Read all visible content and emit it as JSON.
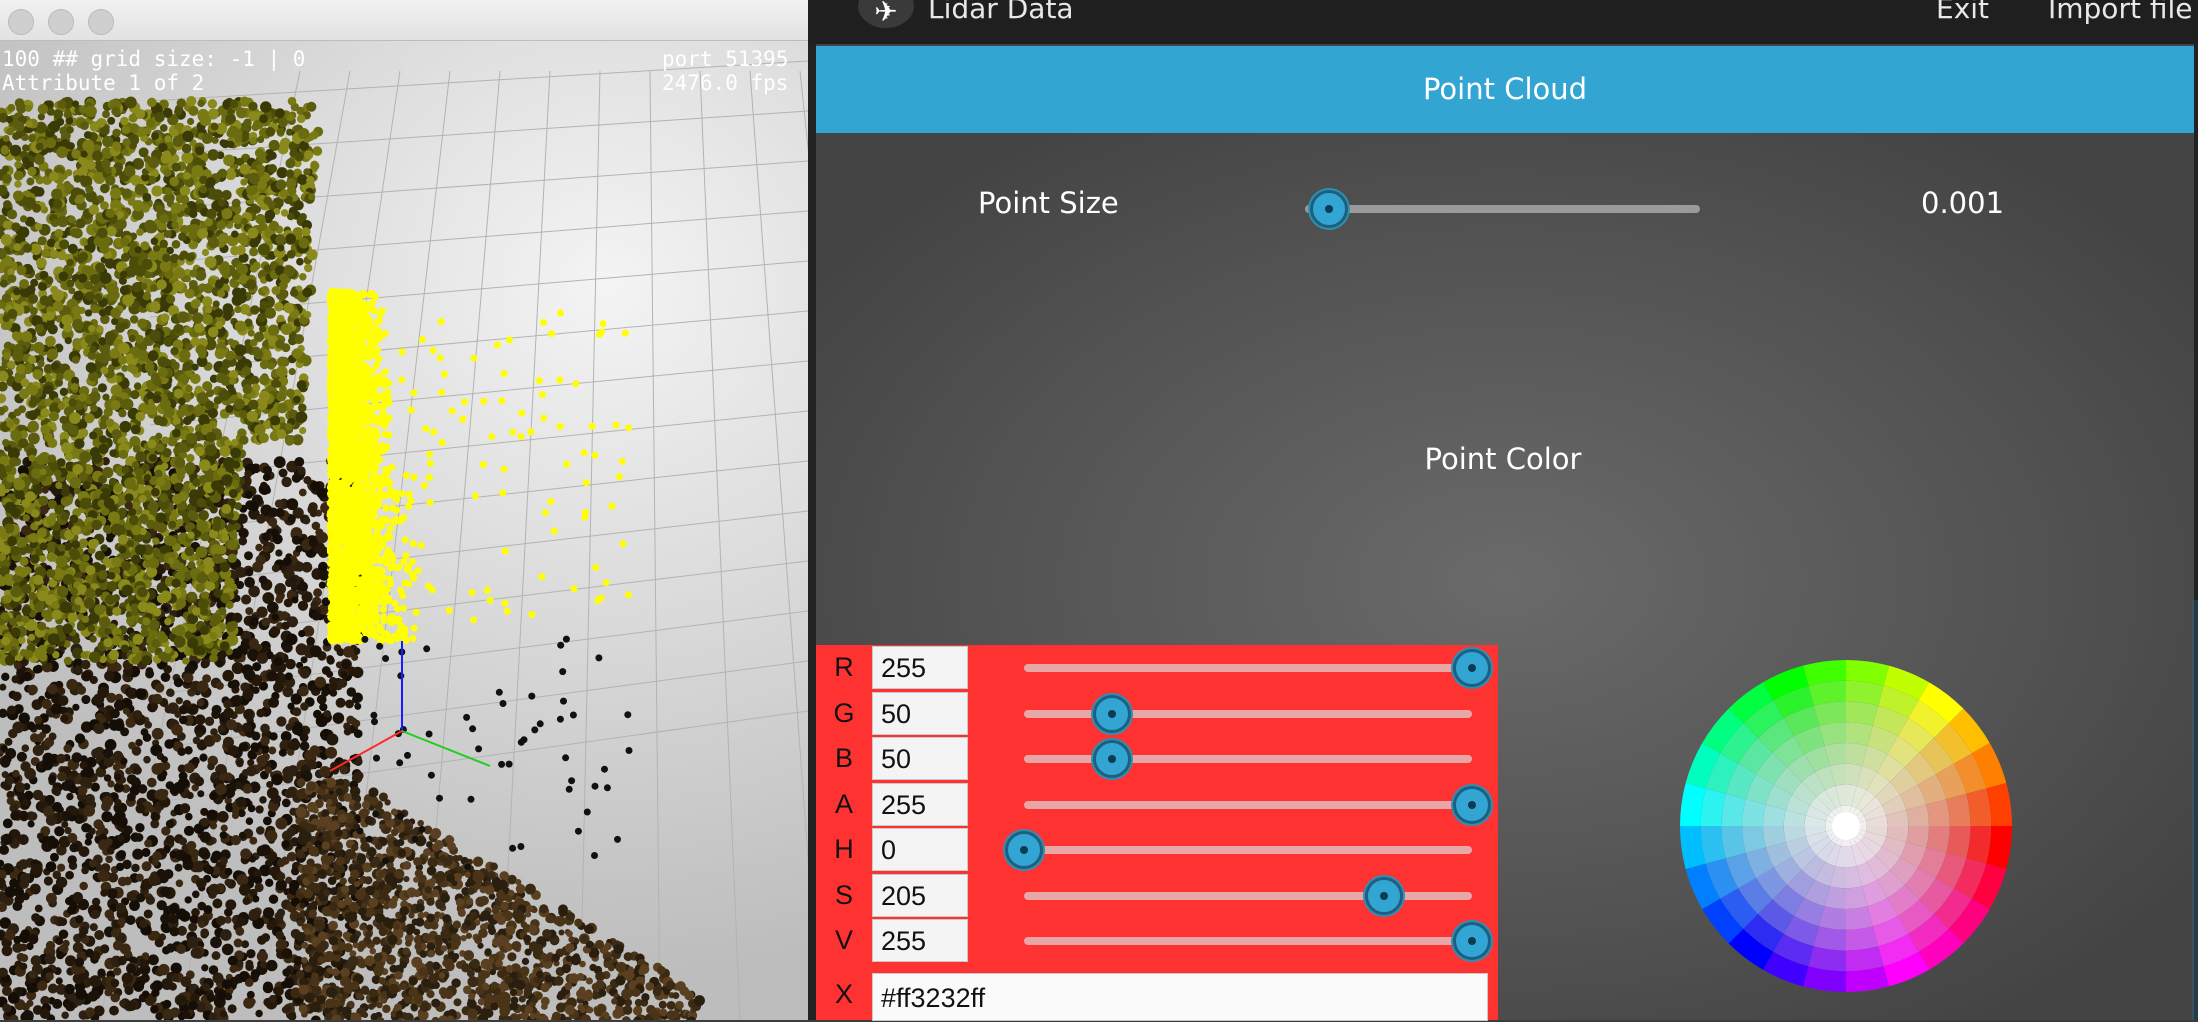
{
  "viewer": {
    "hud_left_line1": "100 ## grid size: -1 | 0",
    "hud_left_line2": "Attribute 1 of 2",
    "hud_right_line1": "port 51395",
    "hud_right_line2": "2476.0 fps",
    "colors": {
      "highlight_points": "#ffff00",
      "olive_points": "#6b6b10",
      "dark_points": "#1a1208"
    }
  },
  "app_bar": {
    "logo_icon": "app-logo-icon",
    "title": "Lidar Data",
    "exit_label": "Exit",
    "import_label": "Import file"
  },
  "section": {
    "title": "Point Cloud",
    "color": "#33a5d3"
  },
  "point_size": {
    "label": "Point Size",
    "value_text": "0.001",
    "slider_fraction": 0.06
  },
  "point_color": {
    "label": "Point Color",
    "channels": [
      {
        "key": "R",
        "value": "255",
        "fraction": 1.0
      },
      {
        "key": "G",
        "value": "50",
        "fraction": 0.196
      },
      {
        "key": "B",
        "value": "50",
        "fraction": 0.196
      },
      {
        "key": "A",
        "value": "255",
        "fraction": 1.0
      },
      {
        "key": "H",
        "value": "0",
        "fraction": 0.0
      },
      {
        "key": "S",
        "value": "205",
        "fraction": 0.804
      },
      {
        "key": "V",
        "value": "255",
        "fraction": 1.0
      }
    ],
    "hex_key": "X",
    "hex_value": "#ff3232ff",
    "swatch_color": "#ff3232"
  }
}
